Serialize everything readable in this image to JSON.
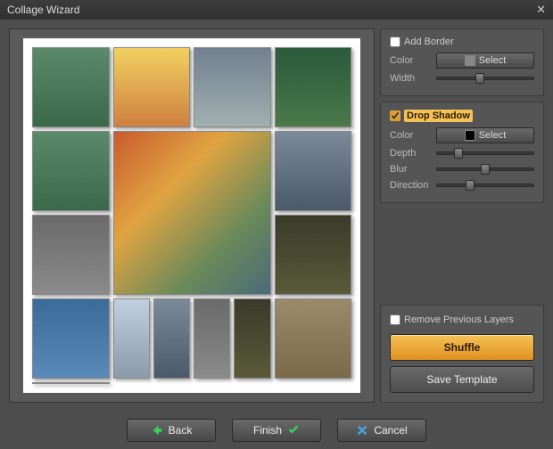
{
  "window": {
    "title": "Collage Wizard"
  },
  "border": {
    "title": "Add Border",
    "checked": false,
    "color_label": "Color",
    "select_label": "Select",
    "width_label": "Width"
  },
  "shadow": {
    "title": "Drop Shadow",
    "checked": true,
    "color_label": "Color",
    "select_label": "Select",
    "color_value": "#000000",
    "depth_label": "Depth",
    "blur_label": "Blur",
    "direction_label": "Direction"
  },
  "actions": {
    "remove_layers": "Remove Previous Layers",
    "remove_layers_checked": false,
    "shuffle": "Shuffle",
    "save_template": "Save Template"
  },
  "footer": {
    "back": "Back",
    "finish": "Finish",
    "cancel": "Cancel"
  }
}
